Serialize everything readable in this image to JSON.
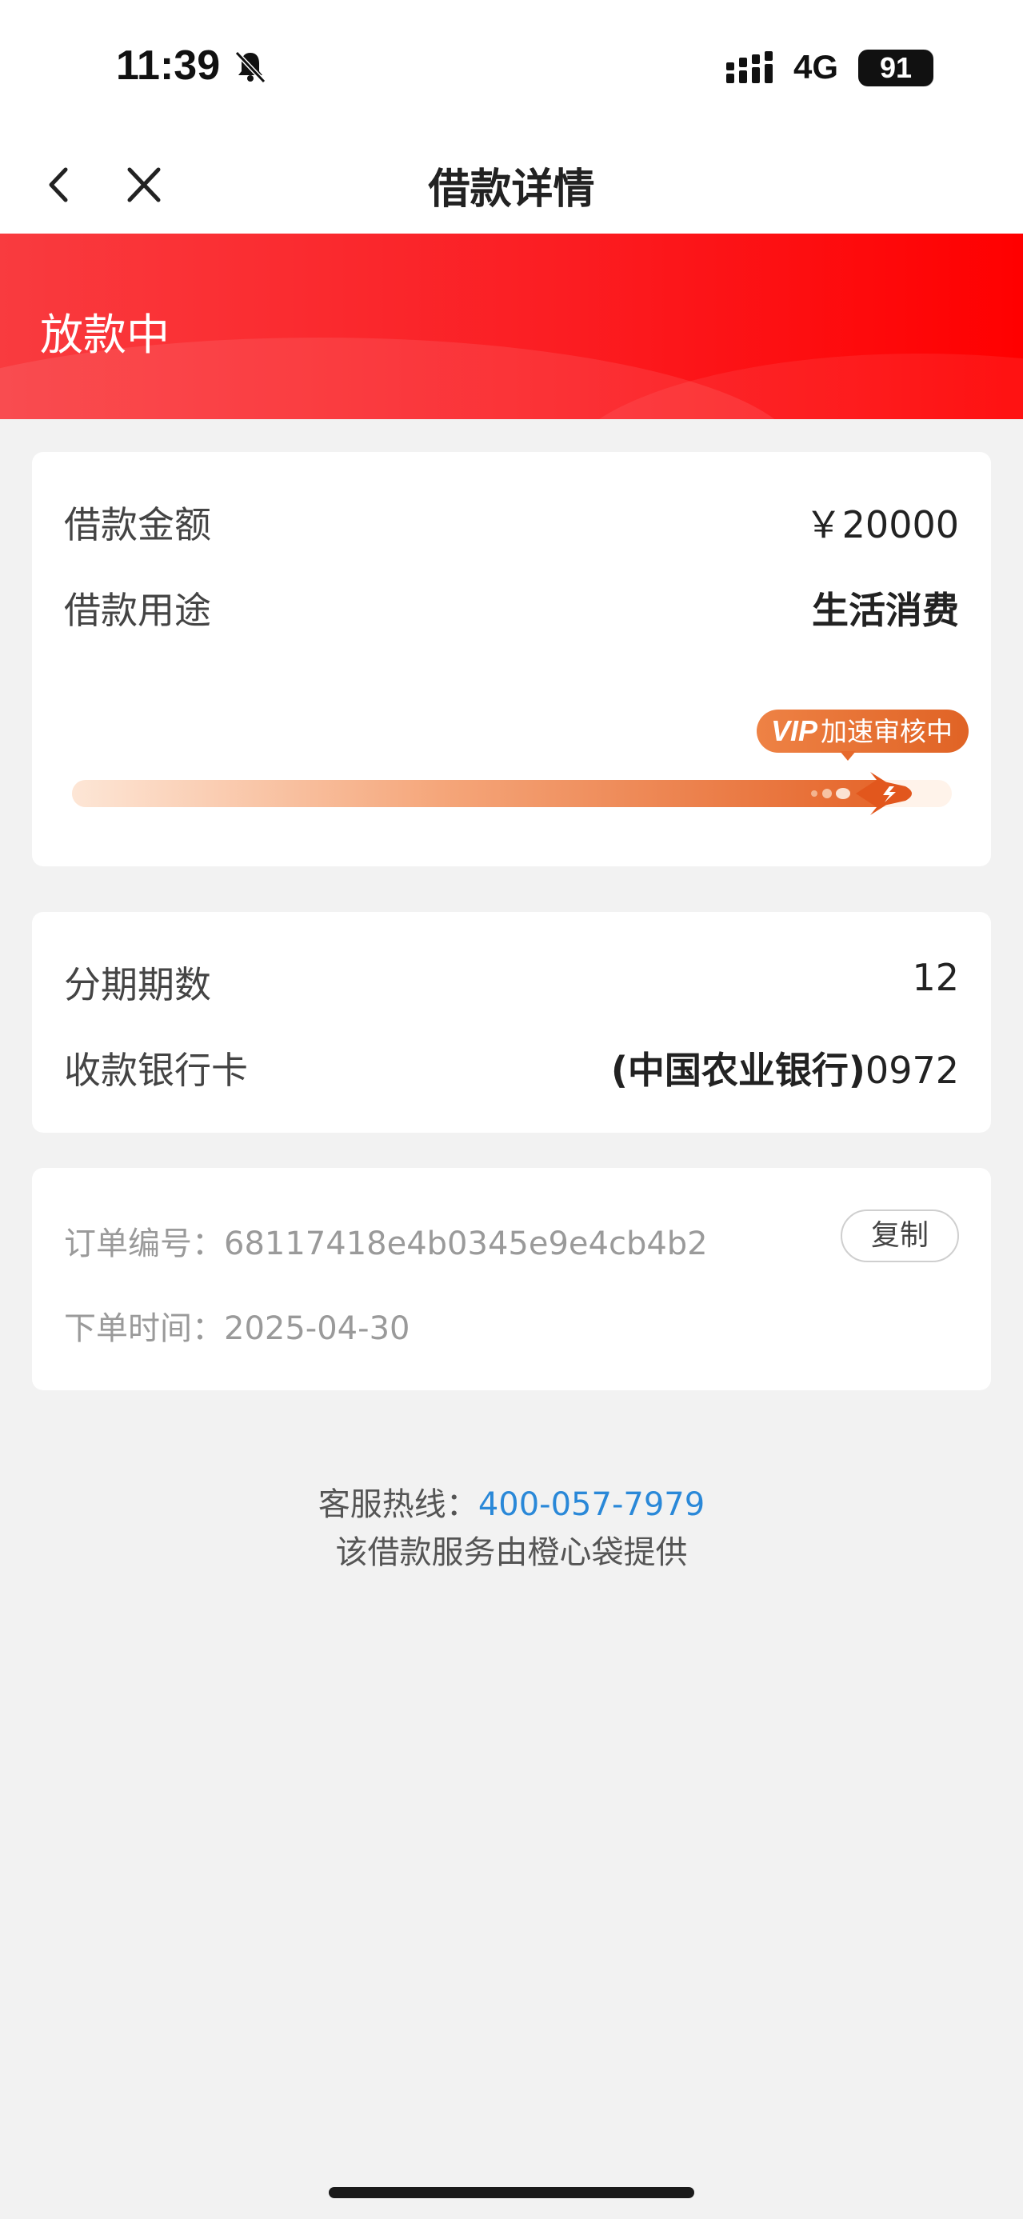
{
  "status_bar": {
    "time": "11:39",
    "network": "4G",
    "battery": "91"
  },
  "nav": {
    "title": "借款详情"
  },
  "banner": {
    "status": "放款中"
  },
  "loan": {
    "amount_label": "借款金额",
    "amount_value": "￥20000",
    "purpose_label": "借款用途",
    "purpose_value": "生活消费",
    "progress_percent": 93,
    "badge_vip": "VIP",
    "badge_text": "加速审核中"
  },
  "installment": {
    "periods_label": "分期期数",
    "periods_value": "12",
    "card_label": "收款银行卡",
    "card_bank": "(中国农业银行)",
    "card_tail": "0972"
  },
  "order": {
    "number_label": "订单编号：",
    "number_value": "68117418e4b0345e9e4cb4b2",
    "copy_label": "复制",
    "time_label": "下单时间：",
    "time_value": "2025-04-30"
  },
  "footer": {
    "hotline_label": "客服热线：",
    "hotline_number": "400-057-7979",
    "provider_note": "该借款服务由橙心袋提供"
  },
  "colors": {
    "banner_red": "#ff1e22",
    "progress_orange": "#e5652a",
    "link_blue": "#2a88d8"
  }
}
